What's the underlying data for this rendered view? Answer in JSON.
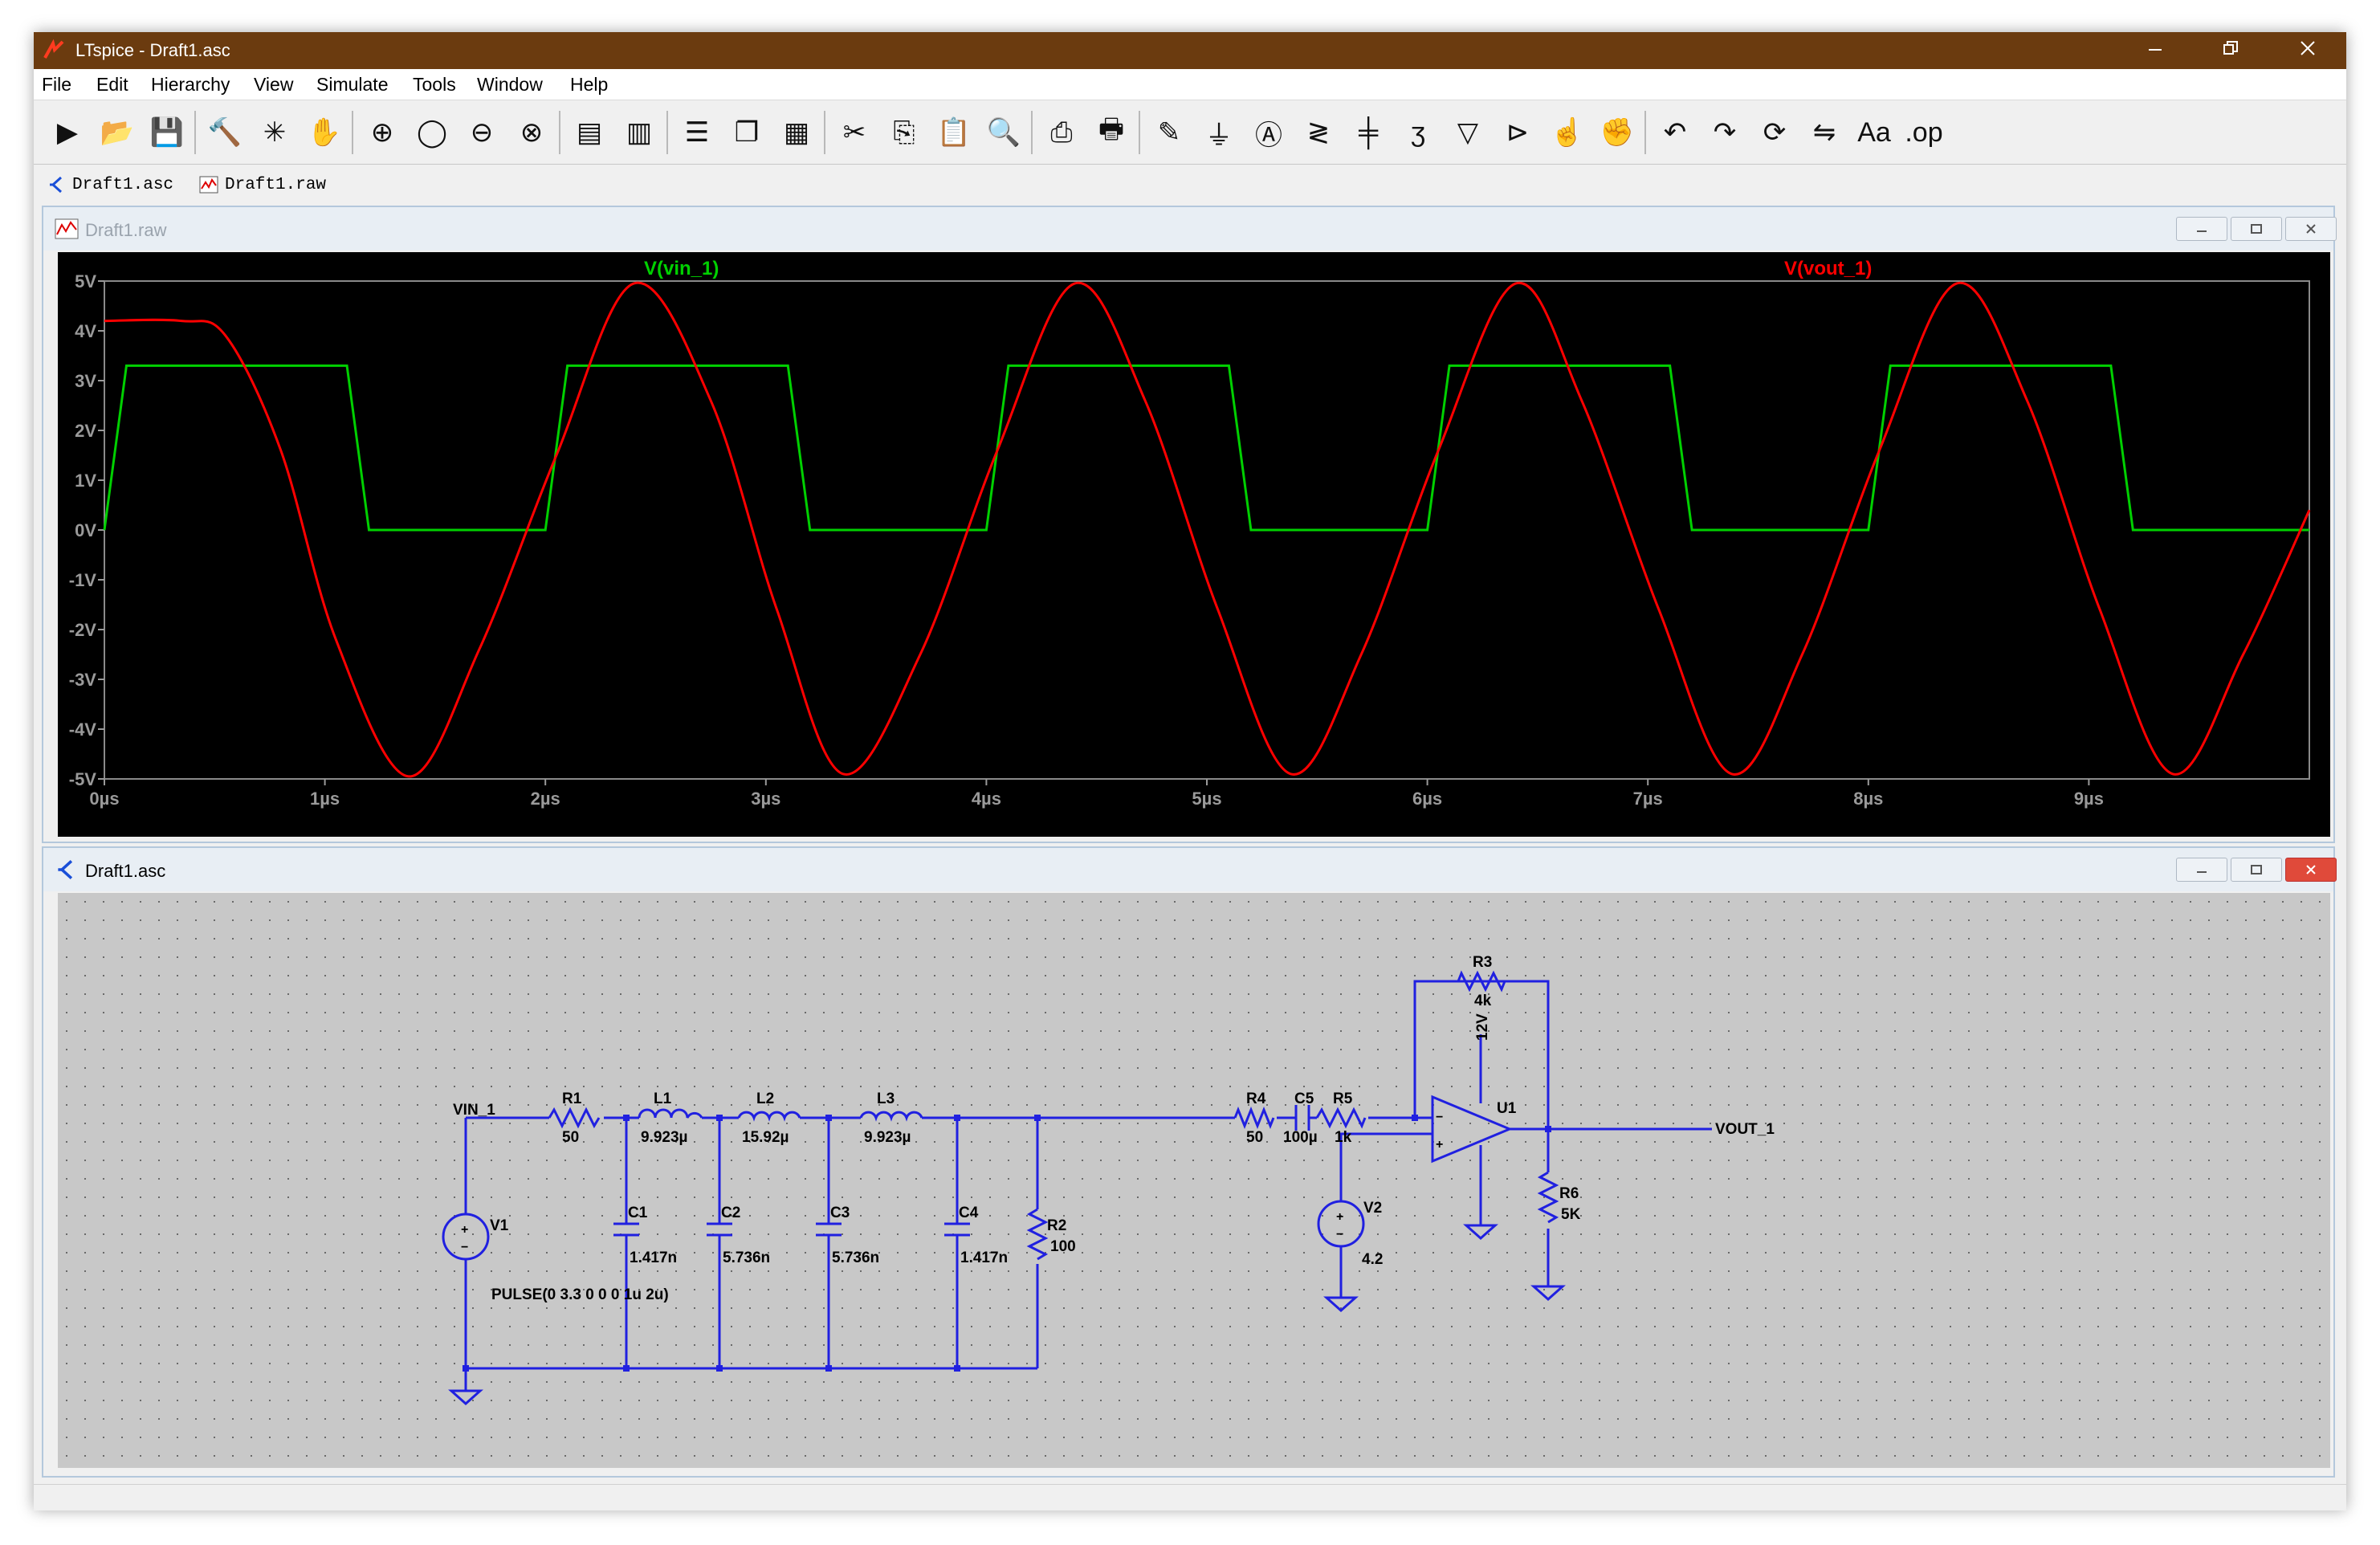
{
  "window": {
    "title": "LTspice - Draft1.asc"
  },
  "menu": [
    "File",
    "Edit",
    "Hierarchy",
    "View",
    "Simulate",
    "Tools",
    "Window",
    "Help"
  ],
  "toolbar_icons": [
    "run-icon",
    "open-icon",
    "save-icon",
    "control-panel-icon",
    "halt-icon",
    "pan-icon",
    "zoom-in-icon",
    "zoom-full-icon",
    "zoom-out-icon",
    "zoom-cancel-icon",
    "autorange-icon",
    "autorange-y-icon",
    "tile-horizontal-icon",
    "cascade-icon",
    "tile-vertical-icon",
    "cut-icon",
    "copy-icon",
    "paste-icon",
    "find-icon",
    "print-setup-icon",
    "print-icon",
    "wire-icon",
    "ground-icon",
    "label-net-icon",
    "resistor-icon",
    "capacitor-icon",
    "inductor-icon",
    "diode-icon",
    "component-icon",
    "move-icon",
    "drag-icon",
    "undo-icon",
    "redo-icon",
    "rotate-icon",
    "mirror-icon",
    "text-icon",
    "spice-directive-icon"
  ],
  "tabs": [
    {
      "label": "Draft1.asc",
      "icon": "schematic-icon"
    },
    {
      "label": "Draft1.raw",
      "icon": "waveform-icon"
    }
  ],
  "plot_window": {
    "title": "Draft1.raw"
  },
  "schematic_window": {
    "title": "Draft1.asc"
  },
  "chart_data": {
    "type": "line",
    "x_unit": "µs",
    "xlim": [
      0,
      10
    ],
    "ylim": [
      -5,
      5
    ],
    "x_ticks": [
      "0µs",
      "1µs",
      "2µs",
      "3µs",
      "4µs",
      "5µs",
      "6µs",
      "7µs",
      "8µs",
      "9µs"
    ],
    "y_ticks": [
      "5V",
      "4V",
      "3V",
      "2V",
      "1V",
      "0V",
      "-1V",
      "-2V",
      "-3V",
      "-4V",
      "-5V"
    ],
    "grid": false,
    "series": [
      {
        "name": "V(vin_1)",
        "color": "#00d000",
        "x": [
          0,
          0.1,
          1.1,
          1.2,
          2.0,
          2.1,
          3.1,
          3.2,
          4.0,
          4.1,
          5.1,
          5.2,
          6.0,
          6.1,
          7.1,
          7.2,
          8.0,
          8.1,
          9.1,
          9.2,
          10.0
        ],
        "y": [
          0,
          3.3,
          3.3,
          0,
          0,
          3.3,
          3.3,
          0,
          0,
          3.3,
          3.3,
          0,
          0,
          3.3,
          3.3,
          0,
          0,
          3.3,
          3.3,
          0,
          0
        ]
      },
      {
        "name": "V(vout_1)",
        "color": "#ff0000",
        "x": [
          0,
          0.35,
          0.55,
          0.8,
          1.05,
          1.38,
          1.7,
          2.05,
          2.4,
          2.75,
          3.05,
          3.35,
          3.7,
          4.05,
          4.4,
          4.72,
          5.05,
          5.38,
          5.7,
          6.05,
          6.4,
          6.7,
          7.05,
          7.38,
          7.7,
          8.05,
          8.4,
          8.72,
          9.05,
          9.38,
          9.7,
          10.0
        ],
        "y": [
          4.2,
          4.2,
          3.9,
          1.6,
          -2.2,
          -4.95,
          -2.4,
          1.5,
          4.95,
          2.6,
          -1.6,
          -4.9,
          -2.5,
          1.6,
          4.95,
          2.6,
          -1.6,
          -4.9,
          -2.5,
          1.6,
          4.95,
          2.6,
          -1.6,
          -4.9,
          -2.5,
          1.6,
          4.95,
          2.6,
          -1.6,
          -4.9,
          -2.5,
          0.4
        ]
      }
    ]
  },
  "schematic": {
    "nets": [
      "VIN_1",
      "VOUT_1"
    ],
    "components": [
      {
        "ref": "R1",
        "value": "50"
      },
      {
        "ref": "L1",
        "value": "9.923µ"
      },
      {
        "ref": "L2",
        "value": "15.92µ"
      },
      {
        "ref": "L3",
        "value": "9.923µ"
      },
      {
        "ref": "C1",
        "value": "1.417n"
      },
      {
        "ref": "C2",
        "value": "5.736n"
      },
      {
        "ref": "C3",
        "value": "5.736n"
      },
      {
        "ref": "C4",
        "value": "1.417n"
      },
      {
        "ref": "R2",
        "value": "100"
      },
      {
        "ref": "R4",
        "value": "50"
      },
      {
        "ref": "C5",
        "value": "100µ"
      },
      {
        "ref": "R5",
        "value": "1k"
      },
      {
        "ref": "R3",
        "value": "4k"
      },
      {
        "ref": "U1",
        "value": ""
      },
      {
        "ref": "V1",
        "value": "PULSE(0 3.3 0 0 0 1u 2u)"
      },
      {
        "ref": "V2",
        "value": "4.2"
      },
      {
        "ref": "R6",
        "value": "5K"
      }
    ],
    "supply_label": "12V"
  }
}
